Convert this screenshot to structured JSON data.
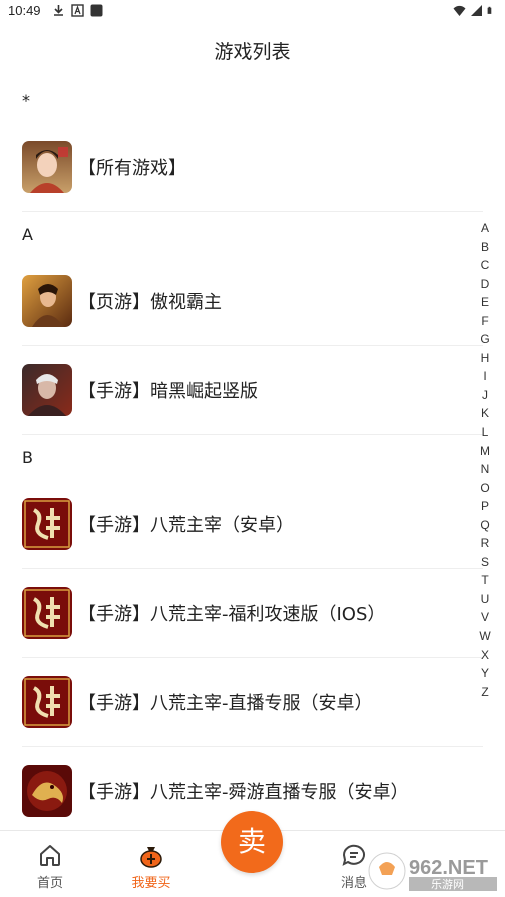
{
  "status_bar": {
    "time": "10:49",
    "icons_left": [
      "download-icon",
      "a-icon",
      "square-icon"
    ],
    "icons_right": [
      "wifi-icon",
      "signal-icon",
      "battery-icon"
    ]
  },
  "header": {
    "title": "游戏列表"
  },
  "sections": [
    {
      "letter": "*",
      "items": [
        {
          "label": "【所有游戏】",
          "icon": "character-portrait-icon"
        }
      ]
    },
    {
      "letter": "A",
      "items": [
        {
          "label": "【页游】傲视霸主",
          "icon": "warrior-portrait-icon"
        },
        {
          "label": "【手游】暗黑崛起竖版",
          "icon": "dark-warrior-portrait-icon"
        }
      ]
    },
    {
      "letter": "B",
      "items": [
        {
          "label": "【手游】八荒主宰（安卓）",
          "icon": "chuanshi-logo-icon"
        },
        {
          "label": "【手游】八荒主宰-福利攻速版（IOS）",
          "icon": "chuanshi-logo-icon"
        },
        {
          "label": "【手游】八荒主宰-直播专服（安卓）",
          "icon": "chuanshi-logo-icon"
        },
        {
          "label": "【手游】八荒主宰-舜游直播专服（安卓）",
          "icon": "dragon-logo-icon"
        }
      ]
    }
  ],
  "alphabet": [
    "A",
    "B",
    "C",
    "D",
    "E",
    "F",
    "G",
    "H",
    "I",
    "J",
    "K",
    "L",
    "M",
    "N",
    "O",
    "P",
    "Q",
    "R",
    "S",
    "T",
    "U",
    "V",
    "W",
    "X",
    "Y",
    "Z"
  ],
  "bottom_nav": {
    "home_label": "首页",
    "buy_label": "我要买",
    "sell_label": "卖",
    "messages_label": "消息",
    "active": "buy"
  },
  "watermark": {
    "text": "962.NET",
    "subtext": "乐游网"
  },
  "colors": {
    "accent": "#f26a1b",
    "active_text": "#f0651a"
  }
}
